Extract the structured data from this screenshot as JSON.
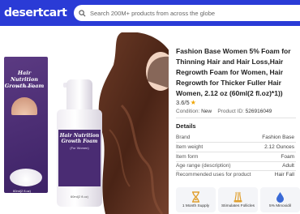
{
  "header": {
    "logo": "desertcart",
    "search_placeholder": "Search 200M+ products from across the globe",
    "bg_color": "#2a3bd6"
  },
  "product_image": {
    "box_title": "Hair Nutrition Growth Foam",
    "box_subtitle": "(For Women)",
    "box_volume": "60ml(2 fl.oz)",
    "bottle_title": "Hair Nutrition Growth Foam",
    "bottle_subtitle": "(For Women)",
    "bottle_volume": "60ml(2 fl.oz)"
  },
  "product": {
    "title": "Fashion Base Women 5% Foam for Thinning Hair and Hair Loss,Hair Regrowth Foam for Women, Hair Regrowth for Thicker Fuller Hair Women, 2.12 oz (60ml(2 fl.oz)*1))",
    "rating": "3.6/5",
    "condition_label": "Condition:",
    "condition_value": "New",
    "product_id_label": "Product ID:",
    "product_id_value": "526916049"
  },
  "details": {
    "heading": "Details",
    "rows": [
      {
        "label": "Brand",
        "value": "Fashion Base"
      },
      {
        "label": "Item weight",
        "value": "2.12 Ounces"
      },
      {
        "label": "Item form",
        "value": "Foam"
      },
      {
        "label": "Age range (description)",
        "value": "Adult"
      },
      {
        "label": "Recommended uses for product",
        "value": "Hair Fall"
      }
    ]
  },
  "badges": [
    {
      "label": "1 Month Supply",
      "icon": "hourglass-icon",
      "color": "#e0a030"
    },
    {
      "label": "Stimulates Follicles",
      "icon": "hair-follicle-icon",
      "color": "#e0a030"
    },
    {
      "label": "5% Minoxidil",
      "icon": "drop-icon",
      "color": "#3a6ad6"
    }
  ]
}
